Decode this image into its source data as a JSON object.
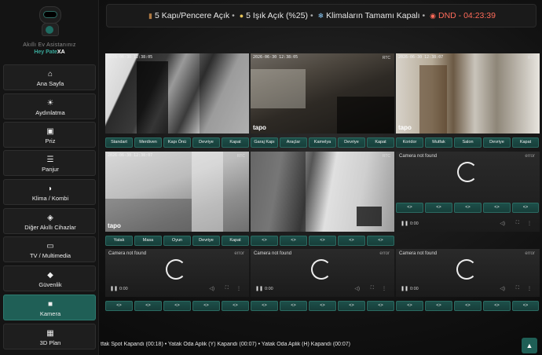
{
  "branding": {
    "subtitle": "Akıllı Ev Asistanınız",
    "name_prefix": "Hey Pate",
    "name_suffix": "XA"
  },
  "sidebar": {
    "items": [
      {
        "label": "Ana Sayfa",
        "icon": "home-icon",
        "active": false
      },
      {
        "label": "Aydınlatma",
        "icon": "lightbulb-icon",
        "active": false
      },
      {
        "label": "Priz",
        "icon": "power-outlet-icon",
        "active": false
      },
      {
        "label": "Panjur",
        "icon": "blinds-icon",
        "active": false
      },
      {
        "label": "Klima / Kombi",
        "icon": "thermostat-icon",
        "active": false
      },
      {
        "label": "Diğer Akıllı Cihazlar",
        "icon": "devices-icon",
        "active": false
      },
      {
        "label": "TV / Multimedia",
        "icon": "tv-icon",
        "active": false
      },
      {
        "label": "Güvenlik",
        "icon": "shield-icon",
        "active": false
      },
      {
        "label": "Kamera",
        "icon": "camera-icon",
        "active": true
      },
      {
        "label": "3D Plan",
        "icon": "floorplan-icon",
        "active": false
      }
    ]
  },
  "status_bar": {
    "doors": "5 Kapı/Pencere Açık",
    "lights": "5 Işık Açık (%25)",
    "climate": "Klimaların Tamamı Kapalı",
    "dnd": "DND - 04:23:39",
    "colors": {
      "dnd": "#ff6b5a",
      "accent": "#1f5f56"
    }
  },
  "cameras": {
    "row1": [
      {
        "timestamp": "2026-06-30 12:38:05",
        "rtc": "",
        "brand": "",
        "buttons": [
          "Standart",
          "Merdiven",
          "Kapı Önü",
          "Devriye",
          "Kapat"
        ]
      },
      {
        "timestamp": "2026-06-30 12:38:05",
        "rtc": "RTC",
        "brand": "tapo",
        "buttons": [
          "Garaj Kapı",
          "Araçlar",
          "Kamelya",
          "Devriye",
          "Kapat"
        ]
      },
      {
        "timestamp": "2026-06-30 12:38:07",
        "rtc": "RTC",
        "brand": "tapo",
        "buttons": [
          "Koridor",
          "Mutfak",
          "Salon",
          "Devriye",
          "Kapat"
        ]
      }
    ],
    "row2": [
      {
        "timestamp": "2026-06-30 12:38:07",
        "rtc": "RTC",
        "brand": "tapo",
        "buttons": [
          "Yatak",
          "Masa",
          "Oyun",
          "Devriye",
          "Kapat"
        ]
      },
      {
        "timestamp": "",
        "rtc": "RTC",
        "brand": "",
        "buttons": [
          "<>",
          "<>",
          "<>",
          "<>",
          "<>"
        ]
      },
      {
        "title": "Camera not found",
        "error": "error",
        "time": "0:00",
        "buttons": [
          "<>",
          "<>",
          "<>",
          "<>",
          "<>"
        ]
      }
    ],
    "row3": [
      {
        "title": "Camera not found",
        "error": "error",
        "time": "0:00",
        "buttons": [
          "<>",
          "<>",
          "<>",
          "<>",
          "<>"
        ]
      },
      {
        "title": "Camera not found",
        "error": "error",
        "time": "0:00",
        "buttons": [
          "<>",
          "<>",
          "<>",
          "<>",
          "<>"
        ]
      },
      {
        "title": "Camera not found",
        "error": "error",
        "time": "0:00",
        "buttons": [
          "<>",
          "<>",
          "<>",
          "<>",
          "<>"
        ]
      }
    ]
  },
  "ticker": {
    "text": "tfak Spot Kapandı (00:18)   •  Yatak Oda Aplik (Y) Kapandı (00:07)   •  Yatak Oda Aplik (H) Kapandı (00:07)"
  }
}
